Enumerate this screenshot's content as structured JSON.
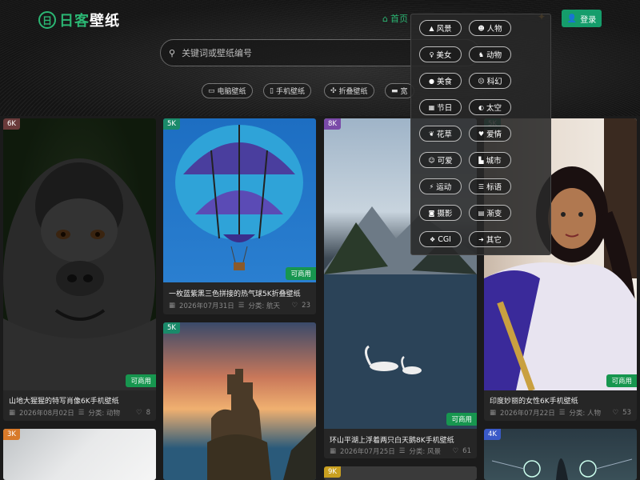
{
  "logo": {
    "mark": "日",
    "name_left": "日客",
    "name_right": "壁纸"
  },
  "nav": {
    "home": "首页"
  },
  "login": {
    "label": "登录"
  },
  "search": {
    "placeholder": "关键词或壁纸编号"
  },
  "quick_links": [
    "电脑壁纸",
    "手机壁纸",
    "折叠壁纸",
    "宽"
  ],
  "categories": [
    {
      "label": "风景",
      "icon": "mountain-icon",
      "glyph": "▲"
    },
    {
      "label": "人物",
      "icon": "smile-icon",
      "glyph": "☻"
    },
    {
      "label": "美女",
      "icon": "person-icon",
      "glyph": "♀"
    },
    {
      "label": "动物",
      "icon": "dog-icon",
      "glyph": "♞"
    },
    {
      "label": "美食",
      "icon": "apple-icon",
      "glyph": "●"
    },
    {
      "label": "科幻",
      "icon": "alien-icon",
      "glyph": "☹"
    },
    {
      "label": "节日",
      "icon": "calendar-icon",
      "glyph": "▦"
    },
    {
      "label": "太空",
      "icon": "globe-icon",
      "glyph": "◐"
    },
    {
      "label": "花草",
      "icon": "leaf-icon",
      "glyph": "❦"
    },
    {
      "label": "爱情",
      "icon": "heart-icon",
      "glyph": "♥"
    },
    {
      "label": "可爱",
      "icon": "baby-icon",
      "glyph": "☺"
    },
    {
      "label": "城市",
      "icon": "city-icon",
      "glyph": "▙"
    },
    {
      "label": "运动",
      "icon": "run-icon",
      "glyph": "⚡"
    },
    {
      "label": "标语",
      "icon": "sign-icon",
      "glyph": "☰"
    },
    {
      "label": "摄影",
      "icon": "camera-icon",
      "glyph": "◙"
    },
    {
      "label": "渐变",
      "icon": "gradient-icon",
      "glyph": "▤"
    },
    {
      "label": "CGI",
      "icon": "cubes-icon",
      "glyph": "❖"
    },
    {
      "label": "其它",
      "icon": "more-icon",
      "glyph": "➜"
    }
  ],
  "cards": [
    {
      "res": "6K",
      "commercial": "可商用",
      "title": "山地大猩猩的特写肖像6K手机壁纸",
      "date": "2026年08月02日",
      "category": "分类: 动物",
      "likes": "8"
    },
    {
      "res": "5K",
      "commercial": "可商用",
      "title": "一枚蓝紫黑三色拼接的热气球5K折叠壁纸",
      "date": "2026年07月31日",
      "category": "分类: 航天",
      "likes": "23"
    },
    {
      "res": "8K",
      "commercial": "可商用",
      "title": "环山平湖上浮着两只白天鹅8K手机壁纸",
      "date": "2026年07月25日",
      "category": "分类: 风景",
      "likes": "61"
    },
    {
      "res": "5K",
      "commercial": "可商用",
      "title": "印度妙丽的女性6K手机壁纸",
      "date": "2026年07月22日",
      "category": "分类: 人物",
      "likes": "53"
    },
    {
      "res": "5K"
    },
    {
      "res": "3K"
    },
    {
      "res": "9K"
    },
    {
      "res": "4K"
    }
  ],
  "colors": {
    "accent": "#2bb673",
    "login": "#159d6b",
    "commercial": "#17964f",
    "star": "#f5a623"
  }
}
